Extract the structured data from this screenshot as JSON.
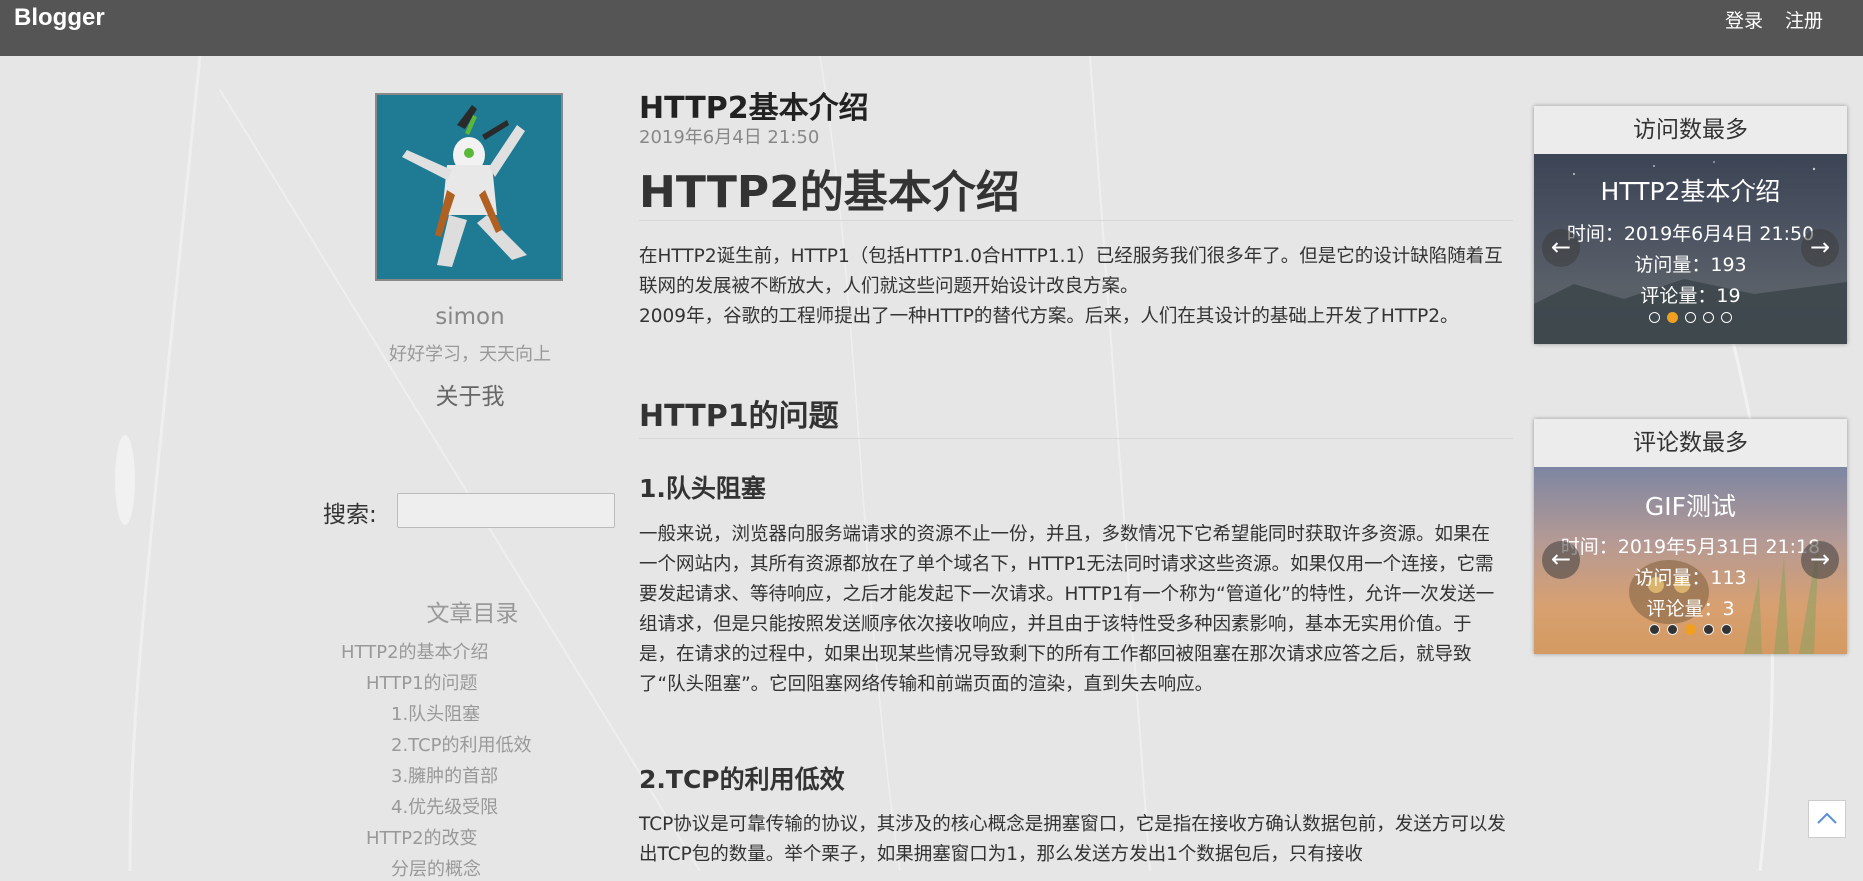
{
  "navbar": {
    "brand": "Blogger",
    "login": "登录",
    "register": "注册"
  },
  "profile": {
    "username": "simon",
    "motto": "好好学习，天天向上",
    "about": "关于我"
  },
  "search": {
    "label": "搜索:",
    "value": ""
  },
  "toc": {
    "title": "文章目录",
    "items": [
      "HTTP2的基本介绍",
      "HTTP1的问题",
      "1.队头阻塞",
      "2.TCP的利用低效",
      "3.臃肿的首部",
      "4.优先级受限",
      "HTTP2的改变",
      "分层的概念"
    ]
  },
  "post": {
    "title": "HTTP2基本介绍",
    "date": "2019年6月4日 21:50",
    "h1": "HTTP2的基本介绍",
    "intro1": "在HTTP2诞生前，HTTP1（包括HTTP1.0合HTTP1.1）已经服务我们很多年了。但是它的设计缺陷随着互联网的发展被不断放大，人们就这些问题开始设计改良方案。",
    "intro2": "2009年，谷歌的工程师提出了一种HTTP的替代方案。后来，人们在其设计的基础上开发了HTTP2。",
    "h2_problems": "HTTP1的问题",
    "h3_1": "1.队头阻塞",
    "p_1": "一般来说，浏览器向服务端请求的资源不止一份，并且，多数情况下它希望能同时获取许多资源。如果在一个网站内，其所有资源都放在了单个域名下，HTTP1无法同时请求这些资源。如果仅用一个连接，它需要发起请求、等待响应，之后才能发起下一次请求。HTTP1有一个称为“管道化”的特性，允许一次发送一组请求，但是只能按照发送顺序依次接收响应，并且由于该特性受多种因素影响，基本无实用价值。于是，在请求的过程中，如果出现某些情况导致剩下的所有工作都回被阻塞在那次请求应答之后，就导致了“队头阻塞”。它回阻塞网络传输和前端页面的渲染，直到失去响应。",
    "h3_2": "2.TCP的利用低效",
    "p_2": "TCP协议是可靠传输的协议，其涉及的核心概念是拥塞窗口，它是指在接收方确认数据包前，发送方可以发出TCP包的数量。举个栗子，如果拥塞窗口为1，那么发送方发出1个数据包后，只有接收"
  },
  "widgets": {
    "most_visited": {
      "title": "访问数最多",
      "slide_title": "HTTP2基本介绍",
      "time": "时间：2019年6月4日 21:50",
      "visits": "访问量：193",
      "comments": "评论量：19",
      "active_index": 1,
      "slide_count": 5
    },
    "most_commented": {
      "title": "评论数最多",
      "slide_title": "GIF测试",
      "time": "时间：2019年5月31日 21:18",
      "visits": "访问量：113",
      "comments": "评论量：3",
      "active_index": 2,
      "slide_count": 5
    }
  },
  "icons": {
    "prev": "arrow-left-icon",
    "next": "arrow-right-icon",
    "back_to_top": "chevron-up-icon"
  },
  "colors": {
    "navbar": "#555555",
    "accent_dot": "#f0a020",
    "back_top": "#5a8ed8"
  }
}
